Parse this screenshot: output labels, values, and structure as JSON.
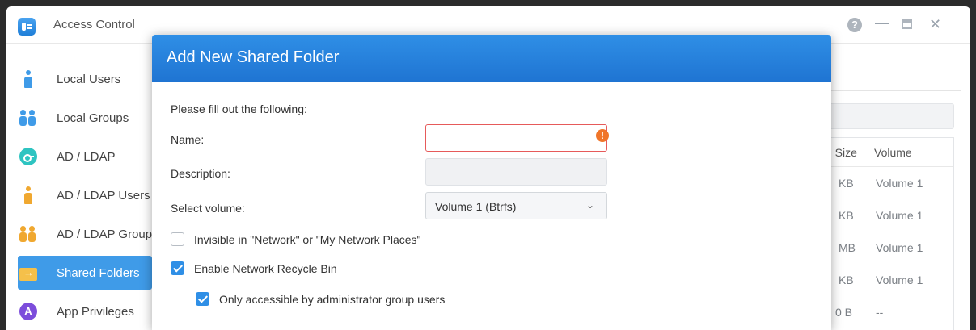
{
  "window": {
    "title": "Access Control",
    "help_label": "?",
    "minimize_label": "—",
    "close_label": "✕"
  },
  "sidebar": {
    "items": [
      {
        "label": "Local Users",
        "icon": "local-user-icon"
      },
      {
        "label": "Local Groups",
        "icon": "local-group-icon"
      },
      {
        "label": "AD / LDAP",
        "icon": "key-icon"
      },
      {
        "label": "AD / LDAP Users",
        "icon": "ad-user-icon"
      },
      {
        "label": "AD / LDAP Groups",
        "icon": "ad-group-icon"
      },
      {
        "label": "Shared Folders",
        "icon": "folder-icon",
        "active": true
      },
      {
        "label": "App Privileges",
        "icon": "app-privileges-icon"
      }
    ]
  },
  "background_table": {
    "headers": [
      "n Size",
      "Volume"
    ],
    "rows": [
      {
        "size": "KB",
        "volume": "Volume 1"
      },
      {
        "size": "KB",
        "volume": "Volume 1"
      },
      {
        "size": "MB",
        "volume": "Volume 1"
      },
      {
        "size": "KB",
        "volume": "Volume 1"
      },
      {
        "size": "0 B",
        "volume": "--"
      }
    ]
  },
  "dialog": {
    "title": "Add New Shared Folder",
    "intro": "Please fill out the following:",
    "name_label": "Name:",
    "name_value": "",
    "name_error_icon": "!",
    "description_label": "Description:",
    "description_value": "",
    "volume_label": "Select volume:",
    "volume_value": "Volume 1 (Btrfs)",
    "volume_caret": "⌄",
    "invisible_label": "Invisible in \"Network\" or \"My Network Places\"",
    "invisible_checked": false,
    "recycle_label": "Enable Network Recycle Bin",
    "recycle_checked": true,
    "admin_only_label": "Only accessible by administrator group users",
    "admin_only_checked": true
  },
  "colors": {
    "accent": "#2f8fe6",
    "error": "#e65a5a",
    "warning_icon": "#f0752a"
  }
}
